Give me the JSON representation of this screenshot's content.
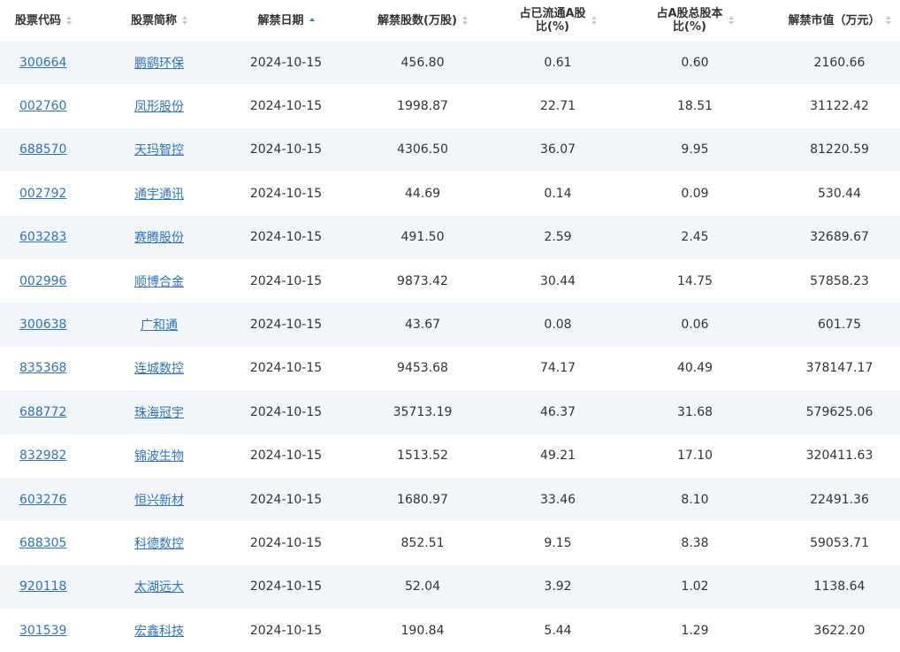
{
  "columns": [
    {
      "label": "股票代码",
      "sort": "both"
    },
    {
      "label": "股票简称",
      "sort": "both"
    },
    {
      "label": "解禁日期",
      "sort": "asc-active"
    },
    {
      "label": "解禁股数(万股)",
      "sort": "both"
    },
    {
      "label": "占已流通A股比(%)",
      "line1": "占已流通A股",
      "line2": "比(%)",
      "sort": "both"
    },
    {
      "label": "占A股总股本比(%)",
      "line1": "占A股总股本",
      "line2": "比(%)",
      "sort": "both"
    },
    {
      "label": "解禁市值（万元）",
      "sort": "both"
    }
  ],
  "rows": [
    {
      "code": "300664",
      "name": "鹏鹞环保",
      "date": "2024-10-15",
      "shares": "456.80",
      "float_ratio": "0.61",
      "total_ratio": "0.60",
      "value": "2160.66"
    },
    {
      "code": "002760",
      "name": "凤形股份",
      "date": "2024-10-15",
      "shares": "1998.87",
      "float_ratio": "22.71",
      "total_ratio": "18.51",
      "value": "31122.42"
    },
    {
      "code": "688570",
      "name": "天玛智控",
      "date": "2024-10-15",
      "shares": "4306.50",
      "float_ratio": "36.07",
      "total_ratio": "9.95",
      "value": "81220.59"
    },
    {
      "code": "002792",
      "name": "通宇通讯",
      "date": "2024-10-15",
      "shares": "44.69",
      "float_ratio": "0.14",
      "total_ratio": "0.09",
      "value": "530.44"
    },
    {
      "code": "603283",
      "name": "赛腾股份",
      "date": "2024-10-15",
      "shares": "491.50",
      "float_ratio": "2.59",
      "total_ratio": "2.45",
      "value": "32689.67"
    },
    {
      "code": "002996",
      "name": "顺博合金",
      "date": "2024-10-15",
      "shares": "9873.42",
      "float_ratio": "30.44",
      "total_ratio": "14.75",
      "value": "57858.23"
    },
    {
      "code": "300638",
      "name": "广和通",
      "date": "2024-10-15",
      "shares": "43.67",
      "float_ratio": "0.08",
      "total_ratio": "0.06",
      "value": "601.75"
    },
    {
      "code": "835368",
      "name": "连城数控",
      "date": "2024-10-15",
      "shares": "9453.68",
      "float_ratio": "74.17",
      "total_ratio": "40.49",
      "value": "378147.17"
    },
    {
      "code": "688772",
      "name": "珠海冠宇",
      "date": "2024-10-15",
      "shares": "35713.19",
      "float_ratio": "46.37",
      "total_ratio": "31.68",
      "value": "579625.06"
    },
    {
      "code": "832982",
      "name": "锦波生物",
      "date": "2024-10-15",
      "shares": "1513.52",
      "float_ratio": "49.21",
      "total_ratio": "17.10",
      "value": "320411.63"
    },
    {
      "code": "603276",
      "name": "恒兴新材",
      "date": "2024-10-15",
      "shares": "1680.97",
      "float_ratio": "33.46",
      "total_ratio": "8.10",
      "value": "22491.36"
    },
    {
      "code": "688305",
      "name": "科德数控",
      "date": "2024-10-15",
      "shares": "852.51",
      "float_ratio": "9.15",
      "total_ratio": "8.38",
      "value": "59053.71"
    },
    {
      "code": "920118",
      "name": "太湖远大",
      "date": "2024-10-15",
      "shares": "52.04",
      "float_ratio": "3.92",
      "total_ratio": "1.02",
      "value": "1138.64"
    },
    {
      "code": "301539",
      "name": "宏鑫科技",
      "date": "2024-10-15",
      "shares": "190.84",
      "float_ratio": "5.44",
      "total_ratio": "1.29",
      "value": "3622.20"
    }
  ],
  "colors": {
    "link": "#2f73b9",
    "stripe": "#f2f6fb",
    "sort_active": "#2f7ec6",
    "sort_inactive": "#c8c8c8"
  },
  "icons": {
    "sort": "sort-arrows-icon",
    "sort_asc": "sort-ascending-icon"
  }
}
